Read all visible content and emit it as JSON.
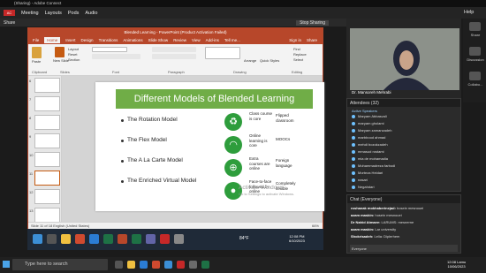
{
  "app": {
    "title_bar": "(Sharing) - Adobe Connect",
    "logo": "AC",
    "menu": [
      "Meeting",
      "Layouts",
      "Pods",
      "Audio"
    ],
    "help": "Help",
    "share_pod": "Share",
    "stop_sharing": "Stop Sharing"
  },
  "ppt": {
    "title": "Blended Learning - PowerPoint (Product Activation Failed)",
    "tabs": [
      "File",
      "Home",
      "Insert",
      "Design",
      "Transitions",
      "Animations",
      "Slide Show",
      "Review",
      "View",
      "Add-ins",
      "Tell me..."
    ],
    "active_tab": "Home",
    "sign_in": "Sign in",
    "share": "Share",
    "ribbon": {
      "paste": "Paste",
      "new_slide": "New Slide",
      "layout": "Layout",
      "reset": "Reset",
      "section": "Section",
      "find": "Find",
      "replace": "Replace",
      "select": "Select",
      "arrange": "Arrange",
      "quick_styles": "Quick Styles",
      "groups": [
        "Clipboard",
        "Slides",
        "Font",
        "Paragraph",
        "Drawing",
        "Editing"
      ]
    },
    "thumb_numbers": [
      "6",
      "7",
      "8",
      "9",
      "10",
      "11",
      "12",
      "13"
    ],
    "status": "Slide 11 of 18     English (United States)",
    "zoom": "66%"
  },
  "slide": {
    "title": "Different Models of Blended Learning",
    "models": [
      "The Rotation Model",
      "The Flex Model",
      "The A La Carte Model",
      "The Enriched Virtual Model"
    ],
    "rows": [
      {
        "icon": "recycle-icon",
        "glyph": "♻",
        "col1": "Class course is core",
        "col2": "Flipped classroom"
      },
      {
        "icon": "wifi-icon",
        "glyph": "◠",
        "col1": "Online learning is core",
        "col2": "MOOCs"
      },
      {
        "icon": "globe-icon",
        "glyph": "⊕",
        "col1": "Extra courses are online",
        "col2": "Foreign language"
      },
      {
        "icon": "location-icon",
        "glyph": "●",
        "col1": "Face-to-face followed by online",
        "col2": "Completely flexible"
      }
    ],
    "watermark_line1": "Activate Windows",
    "watermark_line2": "Go to Settings to activate Windows."
  },
  "inner_taskbar": {
    "temp": "84°F",
    "time": "12:08 PM",
    "date": "6/10/2023"
  },
  "camera": {
    "presenter": "Dr. Mansoreh Mehrabi"
  },
  "right_strip": {
    "items": [
      "Share",
      "Discussion",
      "Collabo..."
    ]
  },
  "attendees": {
    "title": "Attendees",
    "count": "(32)",
    "section": "Active Speakers",
    "names": [
      "Maryam Abbasvali",
      "maryam gholami",
      "Maryam zamanzadeh",
      "marbbood ahmad",
      "mehdi bozokzadeh",
      "mmasud rostami",
      "mia de mohamadia",
      "Mohammadreza farbodi",
      "Morteza Heidari",
      "nasari",
      "Negahdari"
    ]
  },
  "chat": {
    "title": "Chat",
    "audience": "(Everyone)",
    "messages": [
      {
        "from": "roshanak mokhaberinejad:",
        "text": "hosein mesnouei"
      },
      {
        "from": "azam maskin:",
        "text": "hosein mesnouei"
      },
      {
        "from": "Dr Nahid Atmaee:",
        "text": "LARUMS: mesnerne"
      },
      {
        "from": "azam maskin:",
        "text": "Lar university"
      },
      {
        "from": "Shokrisadeh:",
        "text": "Lelia: Diplerhem"
      }
    ],
    "recipient": "Everyone"
  },
  "os": {
    "search_placeholder": "Type here to search",
    "time": "12:08 Lamu",
    "date": "10/06/2023"
  },
  "colors": {
    "ppt_accent": "#b7472a",
    "slide_green": "#70ad47",
    "icon_green": "#2e9d3c"
  }
}
